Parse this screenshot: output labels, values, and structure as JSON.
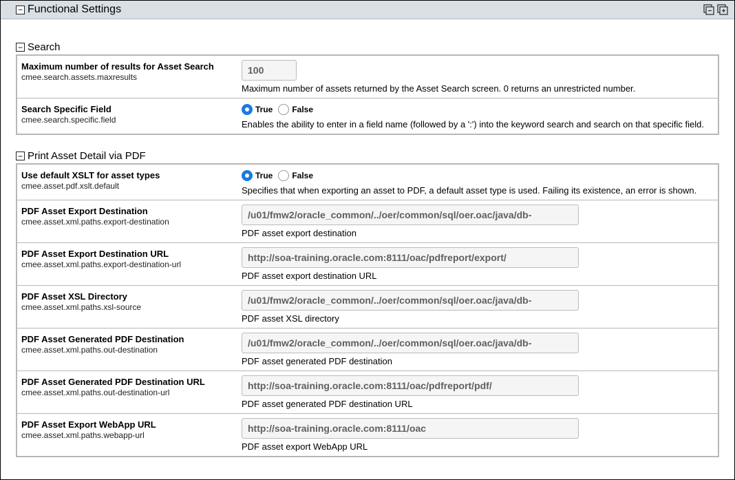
{
  "header": {
    "title": "Functional Settings"
  },
  "sections": {
    "search": {
      "title": "Search",
      "rows": {
        "maxResults": {
          "label": "Maximum number of results for Asset Search",
          "key": "cmee.search.assets.maxresults",
          "value": "100",
          "desc": "Maximum number of assets returned by the Asset Search screen. 0 returns an unrestricted number."
        },
        "specificField": {
          "label": "Search Specific Field",
          "key": "cmee.search.specific.field",
          "trueLabel": "True",
          "falseLabel": "False",
          "desc": "Enables the ability to enter in a field name (followed by a ':') into the keyword search and search on that specific field."
        }
      }
    },
    "pdf": {
      "title": "Print Asset Detail via PDF",
      "rows": {
        "defaultXslt": {
          "label": "Use default XSLT for asset types",
          "key": "cmee.asset.pdf.xslt.default",
          "trueLabel": "True",
          "falseLabel": "False",
          "desc": "Specifies that when exporting an asset to PDF, a default asset type is used. Failing its existence, an error is shown."
        },
        "exportDest": {
          "label": "PDF Asset Export Destination",
          "key": "cmee.asset.xml.paths.export-destination",
          "value": "/u01/fmw2/oracle_common/../oer/common/sql/oer.oac/java/db-",
          "desc": "PDF asset export destination"
        },
        "exportDestUrl": {
          "label": "PDF Asset Export Destination URL",
          "key": "cmee.asset.xml.paths.export-destination-url",
          "value": "http://soa-training.oracle.com:8111/oac/pdfreport/export/",
          "desc": "PDF asset export destination URL"
        },
        "xslDir": {
          "label": "PDF Asset XSL Directory",
          "key": "cmee.asset.xml.paths.xsl-source",
          "value": "/u01/fmw2/oracle_common/../oer/common/sql/oer.oac/java/db-",
          "desc": "PDF asset XSL directory"
        },
        "genPdfDest": {
          "label": "PDF Asset Generated PDF Destination",
          "key": "cmee.asset.xml.paths.out-destination",
          "value": "/u01/fmw2/oracle_common/../oer/common/sql/oer.oac/java/db-",
          "desc": "PDF asset generated PDF destination"
        },
        "genPdfDestUrl": {
          "label": "PDF Asset Generated PDF Destination URL",
          "key": "cmee.asset.xml.paths.out-destination-url",
          "value": "http://soa-training.oracle.com:8111/oac/pdfreport/pdf/",
          "desc": "PDF asset generated PDF destination URL"
        },
        "webappUrl": {
          "label": "PDF Asset Export WebApp URL",
          "key": "cmee.asset.xml.paths.webapp-url",
          "value": "http://soa-training.oracle.com:8111/oac",
          "desc": "PDF asset export WebApp URL"
        }
      }
    }
  }
}
